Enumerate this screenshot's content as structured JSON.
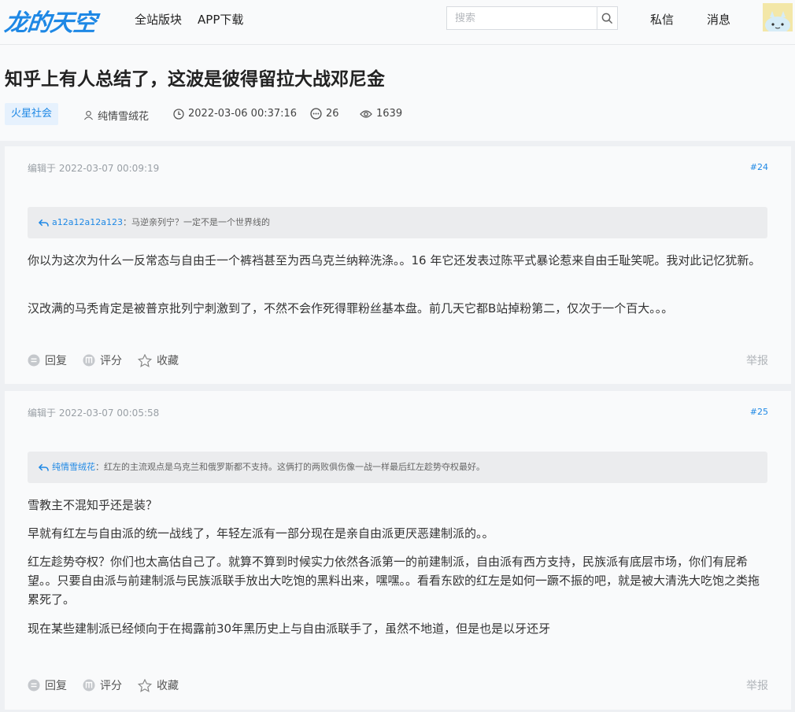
{
  "header": {
    "logo": "龙的天空",
    "nav": [
      "全站版块",
      "APP下载"
    ],
    "search_placeholder": "搜索",
    "messages": "私信",
    "notifications": "消息"
  },
  "thread": {
    "title": "知乎上有人总结了，这波是彼得留拉大战邓尼金",
    "board": "火星社会",
    "author": "纯情雪绒花",
    "datetime": "2022-03-06 00:37:16",
    "replies": "26",
    "views": "1639"
  },
  "posts": [
    {
      "edited": "编辑于 2022-03-07 00:09:19",
      "floor": "#24",
      "quote_user": "a12a12a12a123",
      "quote_text": "：马逆亲列宁？一定不是一个世界线的",
      "paragraphs": [
        "你以为这次为什么一反常态与自由壬一个裤裆甚至为西乌克兰纳粹洗涤。。16 年它还发表过陈平式暴论惹来自由壬耻笑呢。我对此记忆犹新。",
        "汉改满的马秃肯定是被普京批列宁刺激到了，不然不会作死得罪粉丝基本盘。前几天它都B站掉粉第二，仅次于一个百大。。。"
      ],
      "actions": [
        "回复",
        "评分",
        "收藏"
      ],
      "report": "举报"
    },
    {
      "edited": "编辑于 2022-03-07 00:05:58",
      "floor": "#25",
      "quote_user": "纯情雪绒花",
      "quote_text": "：红左的主流观点是乌克兰和俄罗斯都不支持。这俩打的两败俱伤像一战一样最后红左趁势夺权最好。",
      "paragraphs": [
        "雪教主不混知乎还是装？",
        "早就有红左与自由派的统一战线了，年轻左派有一部分现在是亲自由派更厌恶建制派的。。",
        "红左趁势夺权？你们也太高估自己了。就算不算到时候实力依然各派第一的前建制派，自由派有西方支持，民族派有底层市场，你们有屁希望。。只要自由派与前建制派与民族派联手放出大吃饱的黑料出来，嘿嘿。。看看东欧的红左是如何一蹶不振的吧，就是被大清洗大吃饱之类拖累死了。",
        "现在某些建制派已经倾向于在揭露前30年黑历史上与自由派联手了，虽然不地道，但是也是以牙还牙"
      ],
      "actions": [
        "回复",
        "评分",
        "收藏"
      ],
      "report": "举报"
    }
  ],
  "colors": {
    "accent": "#1e88e5",
    "page_bg": "#eef0f3",
    "card_bg": "#f9fafb"
  },
  "icons": [
    "search-icon",
    "user-icon",
    "clock-icon",
    "comment-icon",
    "eye-icon",
    "reply-arrow-icon",
    "reply-icon",
    "rate-icon",
    "star-icon"
  ]
}
